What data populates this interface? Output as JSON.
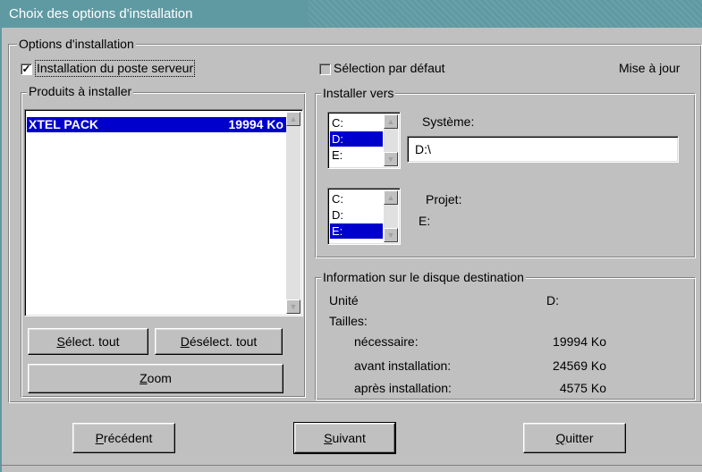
{
  "window": {
    "title": "Choix des options d'installation"
  },
  "options_group": {
    "legend": "Options d'installation"
  },
  "server_checkbox": {
    "checked": true,
    "mark": "✓",
    "label": "Installation du poste serveur"
  },
  "default_checkbox": {
    "checked": false,
    "label": "Sélection par défaut"
  },
  "update_label": "Mise à jour",
  "products": {
    "legend": "Produits à installer",
    "items": [
      {
        "name": "XTEL  PACK",
        "size": "19994  Ko",
        "selected": true
      }
    ]
  },
  "buttons": {
    "select_all": {
      "accel": "S",
      "text": "élect. tout"
    },
    "deselect_all": {
      "accel": "D",
      "text": "ésélect. tout"
    },
    "zoom": {
      "accel": "Z",
      "text": "oom"
    },
    "previous": {
      "accel": "P",
      "text": "récédent"
    },
    "next": {
      "accel": "S",
      "text": "uivant"
    },
    "quit": {
      "accel": "Q",
      "text": "uitter"
    }
  },
  "install_to": {
    "legend": "Installer vers",
    "system_label": "Système:",
    "system_path": "D:\\",
    "drives_system": [
      "C:",
      "D:",
      "E:"
    ],
    "drives_system_selected": 1,
    "project_label": "Projet:",
    "project_value": "E:",
    "drives_project": [
      "C:",
      "D:",
      "E:"
    ],
    "drives_project_selected": 2
  },
  "disk_info": {
    "legend": "Information sur le disque destination",
    "unit_label": "Unité",
    "unit_value": "D:",
    "sizes_label": "Tailles:",
    "required_label": "nécessaire:",
    "required_value": "19994 Ko",
    "before_label": "avant installation:",
    "before_value": "24569 Ko",
    "after_label": "après installation:",
    "after_value": "4575 Ko"
  }
}
